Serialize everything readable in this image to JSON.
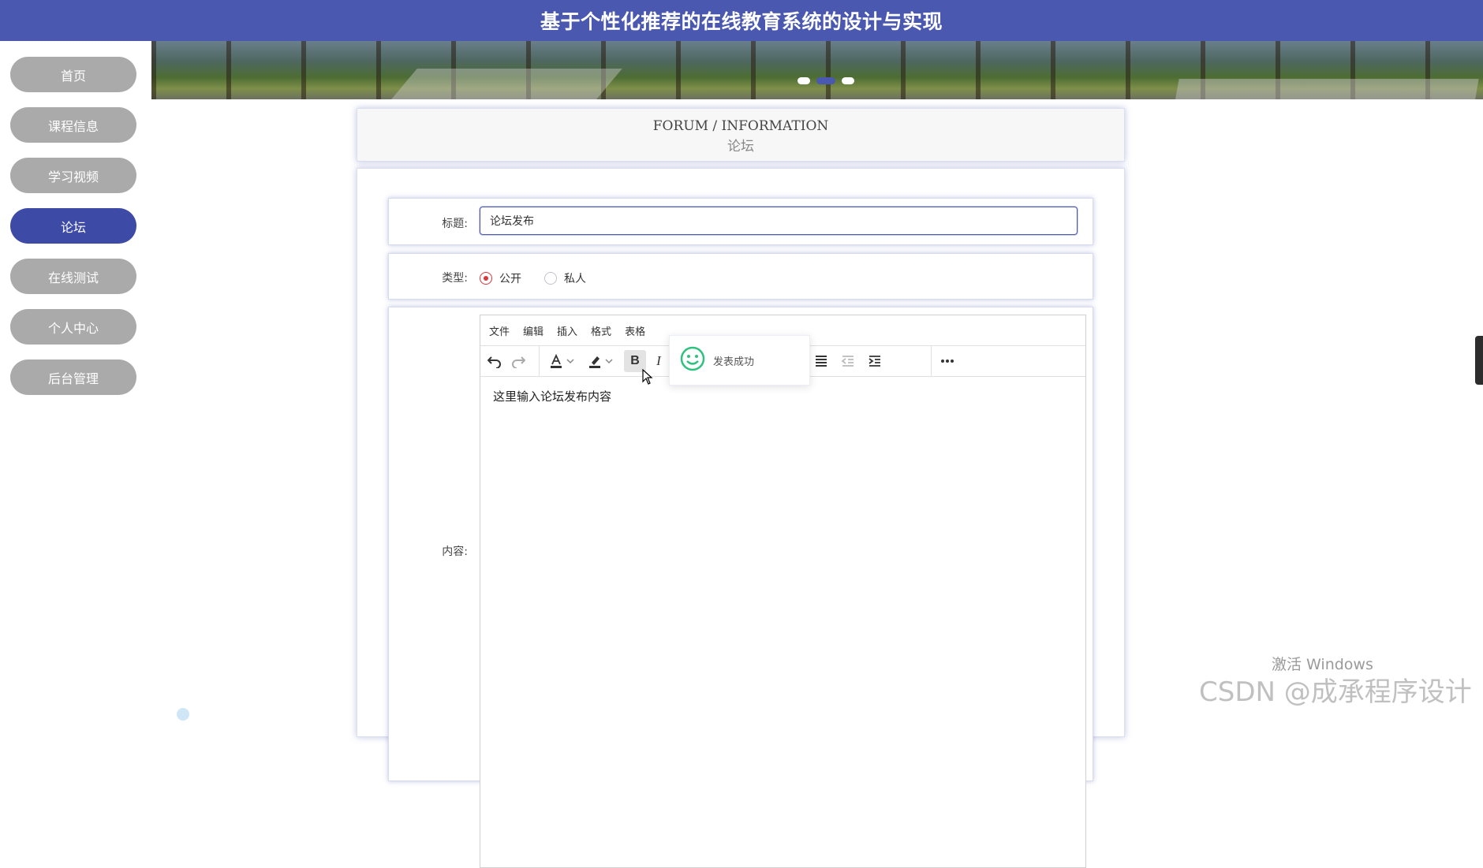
{
  "header": {
    "title": "基于个性化推荐的在线教育系统的设计与实现"
  },
  "sidebar": {
    "items": [
      {
        "label": "首页",
        "active": false
      },
      {
        "label": "课程信息",
        "active": false
      },
      {
        "label": "学习视频",
        "active": false
      },
      {
        "label": "论坛",
        "active": true
      },
      {
        "label": "在线测试",
        "active": false
      },
      {
        "label": "个人中心",
        "active": false
      },
      {
        "label": "后台管理",
        "active": false
      }
    ]
  },
  "banner": {
    "dot_count": 3,
    "active_dot": 2
  },
  "page_header": {
    "en": "FORUM / INFORMATION",
    "cn": "论坛"
  },
  "form": {
    "title_label": "标题:",
    "title_value": "论坛发布",
    "type_label": "类型:",
    "type_options": [
      "公开",
      "私人"
    ],
    "type_selected": "公开",
    "content_label": "内容:"
  },
  "editor": {
    "menu": [
      "文件",
      "编辑",
      "插入",
      "格式",
      "表格"
    ],
    "content": "这里输入论坛发布内容",
    "toolbar_icons": [
      "undo-icon",
      "redo-icon",
      "font-color-icon",
      "highlight-icon",
      "bold-icon",
      "italic-icon",
      "align-right-icon",
      "justify-icon",
      "outdent-icon",
      "indent-icon",
      "more-icon"
    ]
  },
  "toast": {
    "message": "发表成功",
    "icon": "smile-icon"
  },
  "watermark": {
    "windows": "激活 Windows",
    "csdn": "CSDN @成承程序设计"
  },
  "colors": {
    "brand": "#4a58b0",
    "active_nav": "#3d4aa6",
    "inactive_nav": "#aaaaaa",
    "radio_checked": "#d9363e",
    "success": "#2ec27e"
  }
}
